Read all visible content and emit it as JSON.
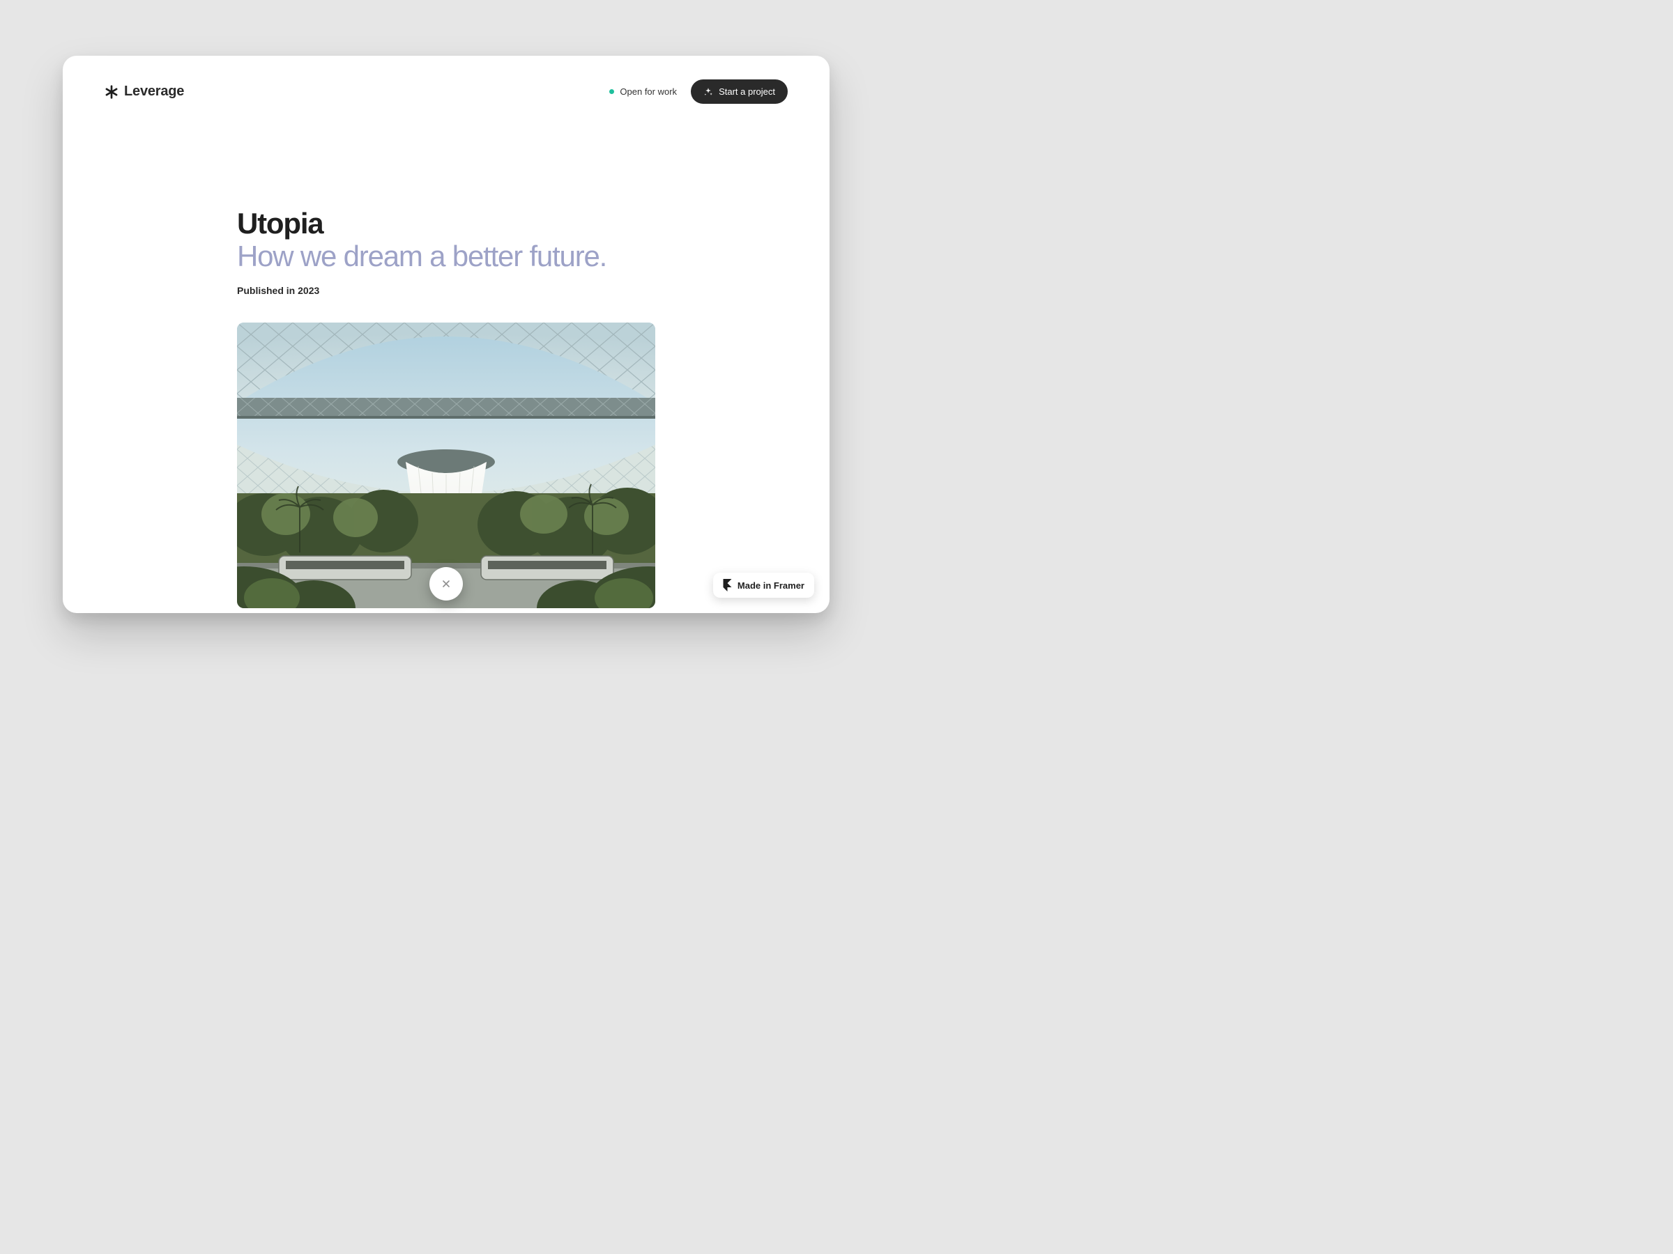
{
  "header": {
    "brand": "Leverage",
    "status_label": "Open for work",
    "cta_label": "Start a project"
  },
  "article": {
    "title": "Utopia",
    "subtitle": "How we dream a better future.",
    "meta": "Published in 2023"
  },
  "badge": {
    "label": "Made in Framer"
  },
  "colors": {
    "accent_subtitle": "#9da2c7",
    "status_dot": "#1fbf9c",
    "cta_bg": "#2a2a2a"
  }
}
